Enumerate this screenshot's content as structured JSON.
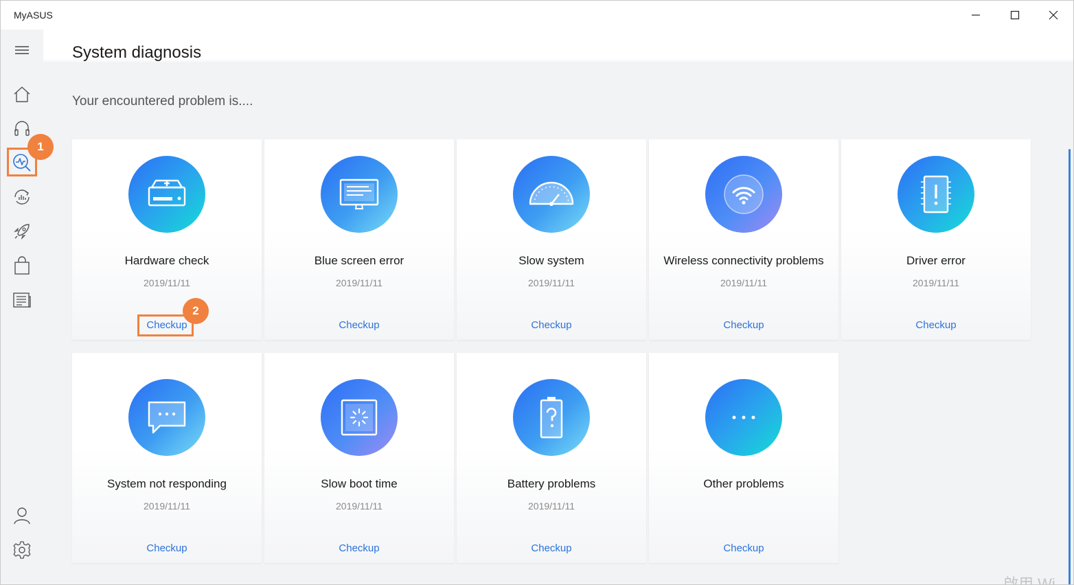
{
  "window": {
    "title": "MyASUS"
  },
  "page": {
    "title": "System diagnosis",
    "subtitle": "Your encountered problem is...."
  },
  "sidebar": {
    "items": [
      {
        "icon": "home-icon"
      },
      {
        "icon": "headset-icon"
      },
      {
        "icon": "diagnosis-icon",
        "selected": true
      },
      {
        "icon": "system-optimization-icon"
      },
      {
        "icon": "rocket-icon"
      },
      {
        "icon": "shopping-bag-icon"
      },
      {
        "icon": "news-icon"
      },
      {
        "icon": "user-icon"
      },
      {
        "icon": "gear-icon"
      }
    ]
  },
  "cards": [
    {
      "name": "Hardware check",
      "date": "2019/11/11",
      "link": "Checkup",
      "icon": "hard-drive-icon"
    },
    {
      "name": "Blue screen error",
      "date": "2019/11/11",
      "link": "Checkup",
      "icon": "monitor-icon"
    },
    {
      "name": "Slow system",
      "date": "2019/11/11",
      "link": "Checkup",
      "icon": "speedometer-icon"
    },
    {
      "name": "Wireless connectivity problems",
      "date": "2019/11/11",
      "link": "Checkup",
      "icon": "wifi-icon"
    },
    {
      "name": "Driver error",
      "date": "2019/11/11",
      "link": "Checkup",
      "icon": "driver-chip-icon"
    },
    {
      "name": "System not responding",
      "date": "2019/11/11",
      "link": "Checkup",
      "icon": "chat-bubble-icon"
    },
    {
      "name": "Slow boot time",
      "date": "2019/11/11",
      "link": "Checkup",
      "icon": "loading-screen-icon"
    },
    {
      "name": "Battery problems",
      "date": "2019/11/11",
      "link": "Checkup",
      "icon": "battery-icon"
    },
    {
      "name": "Other problems",
      "date": "",
      "link": "Checkup",
      "icon": "more-dots-icon"
    }
  ],
  "annotations": {
    "step1": "1",
    "step2": "2",
    "highlight_color": "#f0813e"
  },
  "colors": {
    "link": "#2a73d9",
    "accent": "#2c6ff5"
  },
  "watermark": "啟用 Wi"
}
